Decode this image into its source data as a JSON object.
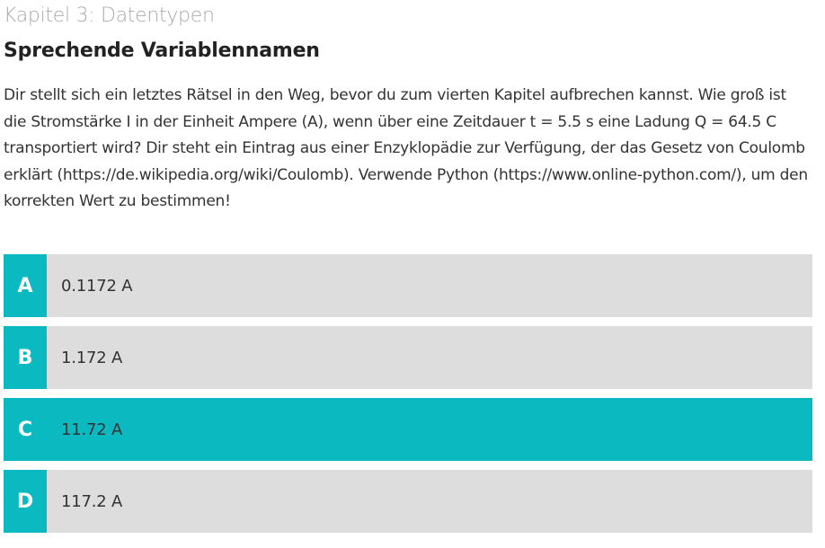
{
  "header": {
    "chapter": "Kapitel 3: Datentypen",
    "title": "Sprechende Variablennamen"
  },
  "question": {
    "text": "Dir stellt sich ein letztes Rätsel in den Weg, bevor du zum vierten Kapitel aufbrechen kannst. Wie groß ist die Stromstärke I in der Einheit Ampere (A), wenn über eine Zeitdauer t = 5.5 s eine Ladung Q = 64.5 C transportiert wird? Dir steht ein Eintrag aus einer Enzyklopädie zur Verfügung, der das Gesetz von Coulomb erklärt (https://de.wikipedia.org/wiki/Coulomb). Verwende Python (https://www.online-python.com/), um den korrekten Wert zu bestimmen!"
  },
  "answers": [
    {
      "letter": "A",
      "text": "0.1172 A"
    },
    {
      "letter": "B",
      "text": "1.172 A"
    },
    {
      "letter": "C",
      "text": "11.72 A"
    },
    {
      "letter": "D",
      "text": "117.2 A"
    }
  ],
  "colors": {
    "accent": "#0bbac0",
    "option_bg": "#dddddd"
  }
}
